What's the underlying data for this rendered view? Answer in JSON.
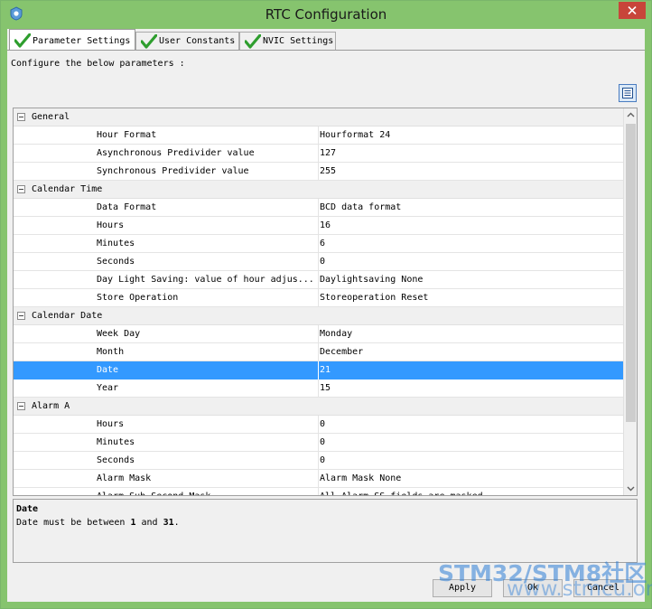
{
  "window": {
    "title": "RTC Configuration"
  },
  "tabs": [
    {
      "label": "Parameter Settings",
      "active": true
    },
    {
      "label": "User Constants",
      "active": false
    },
    {
      "label": "NVIC Settings",
      "active": false
    }
  ],
  "instruction": "Configure the below parameters :",
  "groups": [
    {
      "name": "General",
      "params": [
        {
          "name": "Hour Format",
          "value": "Hourformat 24"
        },
        {
          "name": "Asynchronous Predivider value",
          "value": "127"
        },
        {
          "name": "Synchronous Predivider value",
          "value": "255"
        }
      ]
    },
    {
      "name": "Calendar Time",
      "params": [
        {
          "name": "Data Format",
          "value": "BCD data format"
        },
        {
          "name": "Hours",
          "value": "16"
        },
        {
          "name": "Minutes",
          "value": "6"
        },
        {
          "name": "Seconds",
          "value": "0"
        },
        {
          "name": "Day Light Saving: value of hour adjus...",
          "value": "Daylightsaving None"
        },
        {
          "name": "Store Operation",
          "value": "Storeoperation Reset"
        }
      ]
    },
    {
      "name": "Calendar Date",
      "params": [
        {
          "name": "Week Day",
          "value": "Monday"
        },
        {
          "name": "Month",
          "value": "December"
        },
        {
          "name": "Date",
          "value": "21",
          "selected": true
        },
        {
          "name": "Year",
          "value": "15"
        }
      ]
    },
    {
      "name": "Alarm A",
      "params": [
        {
          "name": "Hours",
          "value": "0"
        },
        {
          "name": "Minutes",
          "value": "0"
        },
        {
          "name": "Seconds",
          "value": "0"
        },
        {
          "name": "Alarm Mask",
          "value": "Alarm Mask None"
        },
        {
          "name": "Alarm Sub Second Mask",
          "value": "All Alarm SS fields are masked."
        }
      ]
    }
  ],
  "description": {
    "title": "Date",
    "text_prefix": "Date must be between ",
    "min": "1",
    "text_middle": " and ",
    "max": "31",
    "text_suffix": "."
  },
  "buttons": {
    "apply": "Apply",
    "ok": "Ok",
    "cancel": "Cancel"
  },
  "watermark": {
    "line1": "STM32/STM8社区",
    "line2": "www.stmcu.org"
  },
  "colors": {
    "frame": "#86c46e",
    "selection": "#3399ff",
    "close": "#c8453a",
    "check": "#2e9e2e"
  }
}
